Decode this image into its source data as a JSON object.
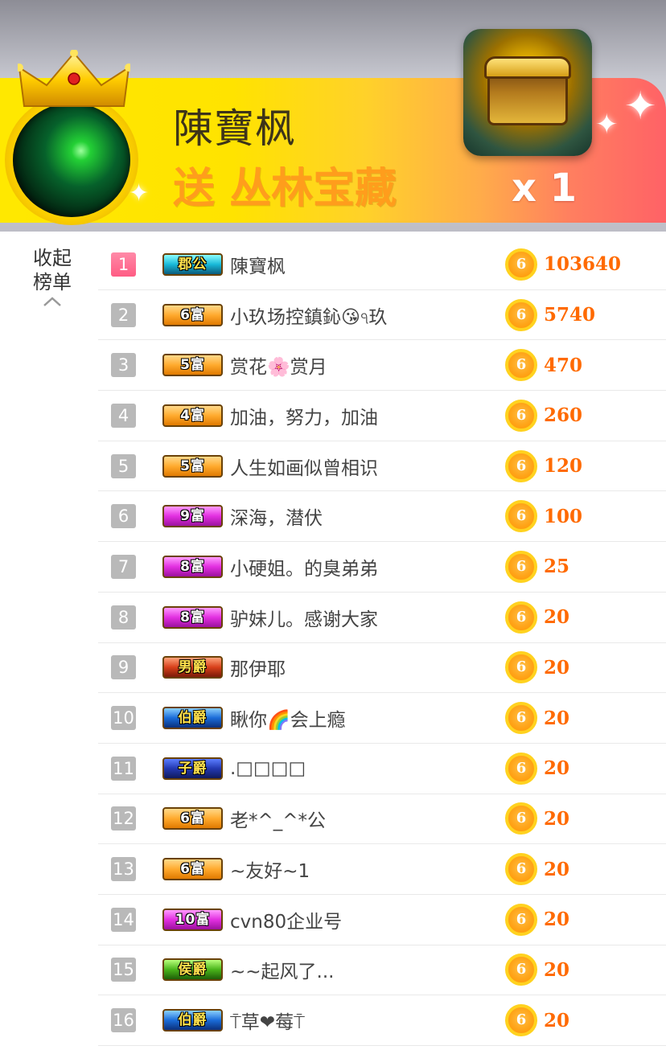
{
  "banner": {
    "sender_name": "陳寶枫",
    "gift_text": "送 丛林宝藏",
    "count": "x 1"
  },
  "collapse": {
    "label": "收起榜单"
  },
  "coin_glyph": "6",
  "ranking": [
    {
      "rank": "1",
      "badge": "郡公",
      "badge_style": "cyan",
      "name": "陳寶枫",
      "score": "103640"
    },
    {
      "rank": "2",
      "badge": "6富",
      "badge_style": "orange",
      "name": "小玖场控鎮鈊😘ঀ玖",
      "score": "5740"
    },
    {
      "rank": "3",
      "badge": "5富",
      "badge_style": "orange",
      "name": "赏花🌸赏月",
      "score": "470"
    },
    {
      "rank": "4",
      "badge": "4富",
      "badge_style": "orange",
      "name": "加油，努力，加油",
      "score": "260"
    },
    {
      "rank": "5",
      "badge": "5富",
      "badge_style": "orange",
      "name": "人生如画似曾相识",
      "score": "120"
    },
    {
      "rank": "6",
      "badge": "9富",
      "badge_style": "magenta",
      "name": "深海，潜伏",
      "score": "100"
    },
    {
      "rank": "7",
      "badge": "8富",
      "badge_style": "magenta",
      "name": "小硬姐。的臭弟弟",
      "score": "25"
    },
    {
      "rank": "8",
      "badge": "8富",
      "badge_style": "magenta",
      "name": "驴妹儿。感谢大家",
      "score": "20"
    },
    {
      "rank": "9",
      "badge": "男爵",
      "badge_style": "red",
      "name": "那伊耶",
      "score": "20"
    },
    {
      "rank": "10",
      "badge": "伯爵",
      "badge_style": "blue",
      "name": "瞅你🌈会上瘾",
      "score": "20"
    },
    {
      "rank": "11",
      "badge": "子爵",
      "badge_style": "navy",
      "name": ".□□□□",
      "score": "20"
    },
    {
      "rank": "12",
      "badge": "6富",
      "badge_style": "orange",
      "name": "老*^_^*公",
      "score": "20"
    },
    {
      "rank": "13",
      "badge": "6富",
      "badge_style": "orange",
      "name": "~友好~1",
      "score": "20"
    },
    {
      "rank": "14",
      "badge": "10富",
      "badge_style": "magenta",
      "name": "cvn80企业号",
      "score": "20"
    },
    {
      "rank": "15",
      "badge": "侯爵",
      "badge_style": "green",
      "name": "~~起风了...",
      "score": "20"
    },
    {
      "rank": "16",
      "badge": "伯爵",
      "badge_style": "blue",
      "name": "⍑草❤莓⍑",
      "score": "20"
    }
  ]
}
